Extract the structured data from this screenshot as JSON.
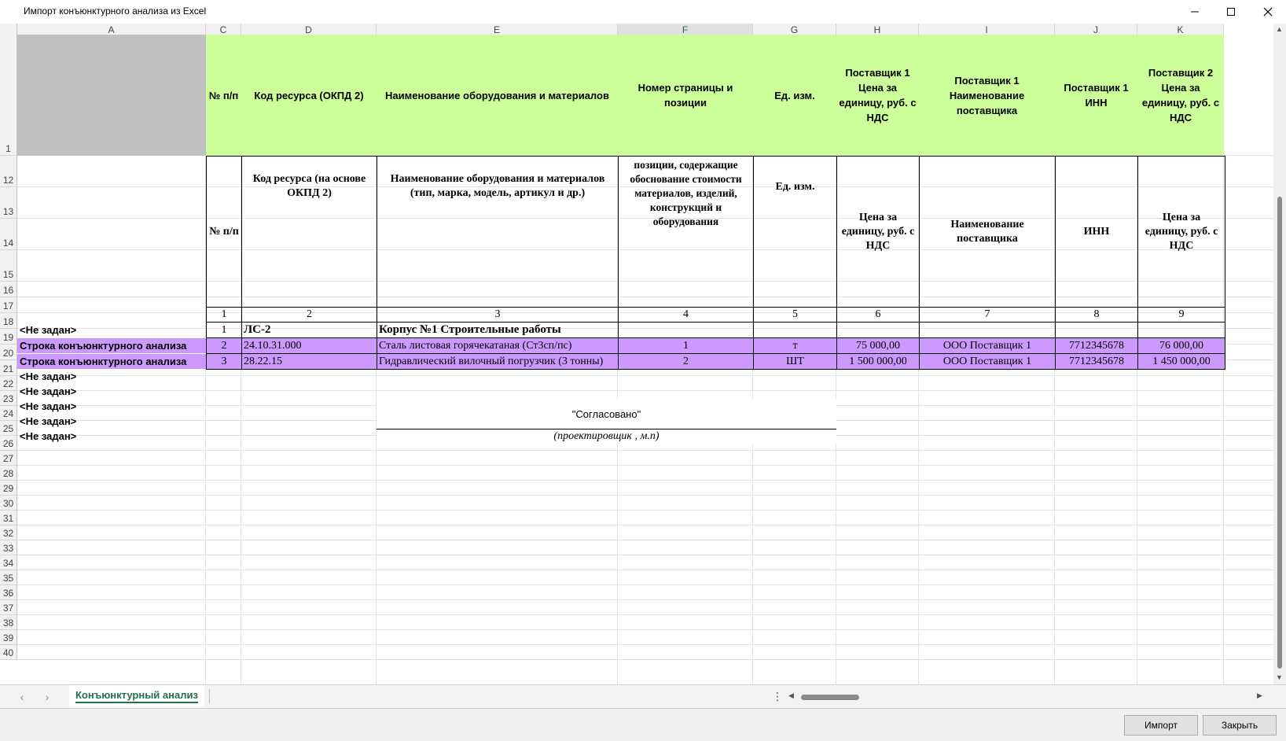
{
  "window": {
    "title": "Импорт конъюнктурного анализа из Excel"
  },
  "columns": [
    "A",
    "C",
    "D",
    "E",
    "F",
    "G",
    "H",
    "I",
    "J",
    "K"
  ],
  "rows": [
    "1",
    "12",
    "13",
    "14",
    "15",
    "16",
    "17",
    "18",
    "19",
    "20",
    "21",
    "22",
    "23",
    "24",
    "25",
    "26",
    "27",
    "28",
    "29",
    "30",
    "31",
    "32",
    "33",
    "34",
    "35",
    "36",
    "37",
    "38",
    "39",
    "40"
  ],
  "header_main": {
    "c": "№ п/п",
    "d": "Код ресурса (ОКПД 2)",
    "e": "Наименование оборудования и материалов",
    "f": "Номер страницы и позиции",
    "g": "Ед. изм.",
    "h": "Поставщик 1 Цена за единицу, руб. с НДС",
    "i": "Поставщик 1 Наименование поставщика",
    "j": "Поставщик 1 ИНН",
    "k": "Поставщик 2 Цена за единицу, руб. с НДС"
  },
  "header_doc": {
    "c": "№ п/п",
    "d": "Код ресурса (на основе ОКПД 2)",
    "e": "Наименование оборудования и материалов (тип, марка, модель, артикул и др.)",
    "f": "позиции, содержащие обоснование стоимости материалов, изделий, конструкций и оборудования",
    "g": "Ед. изм.",
    "h": "Цена за единицу, руб. с НДС",
    "i": "Наименование поставщика",
    "j": "ИНН",
    "k": "Цена за единицу, руб. с НДС"
  },
  "numbering": [
    "1",
    "2",
    "3",
    "4",
    "5",
    "6",
    "7",
    "8",
    "9"
  ],
  "row19": {
    "label": "<Не задан>",
    "num": "1",
    "code": "ЛС-2",
    "name": "Корпус №1 Строительные работы"
  },
  "data_rows": [
    {
      "label": "Строка конъюнктурного анализа",
      "num": "2",
      "code": "24.10.31.000",
      "name": "Сталь листовая горячекатаная (Ст3сп/пс)",
      "page": "1",
      "unit": "т",
      "price1": "75 000,00",
      "supplier1": "ООО Поставщик 1",
      "inn1": "7712345678",
      "price2": "76 000,00"
    },
    {
      "label": "Строка конъюнктурного анализа",
      "num": "3",
      "code": "28.22.15",
      "name": "Гидравлический вилочный погрузчик (3 тонны)",
      "page": "2",
      "unit": "ШТ",
      "price1": "1 500 000,00",
      "supplier1": "ООО Поставщик 1",
      "inn1": "7712345678",
      "price2": "1 450 000,00"
    }
  ],
  "empty_labels": [
    "<Не задан>",
    "<Не задан>",
    "<Не задан>",
    "<Не задан>",
    "<Не задан>"
  ],
  "approved": "\"Согласовано\"",
  "designer_note": "(проектировщик , м.п)",
  "sheet_tab": "Конъюнктурный анализ",
  "buttons": {
    "import": "Импорт",
    "close": "Закрыть"
  }
}
